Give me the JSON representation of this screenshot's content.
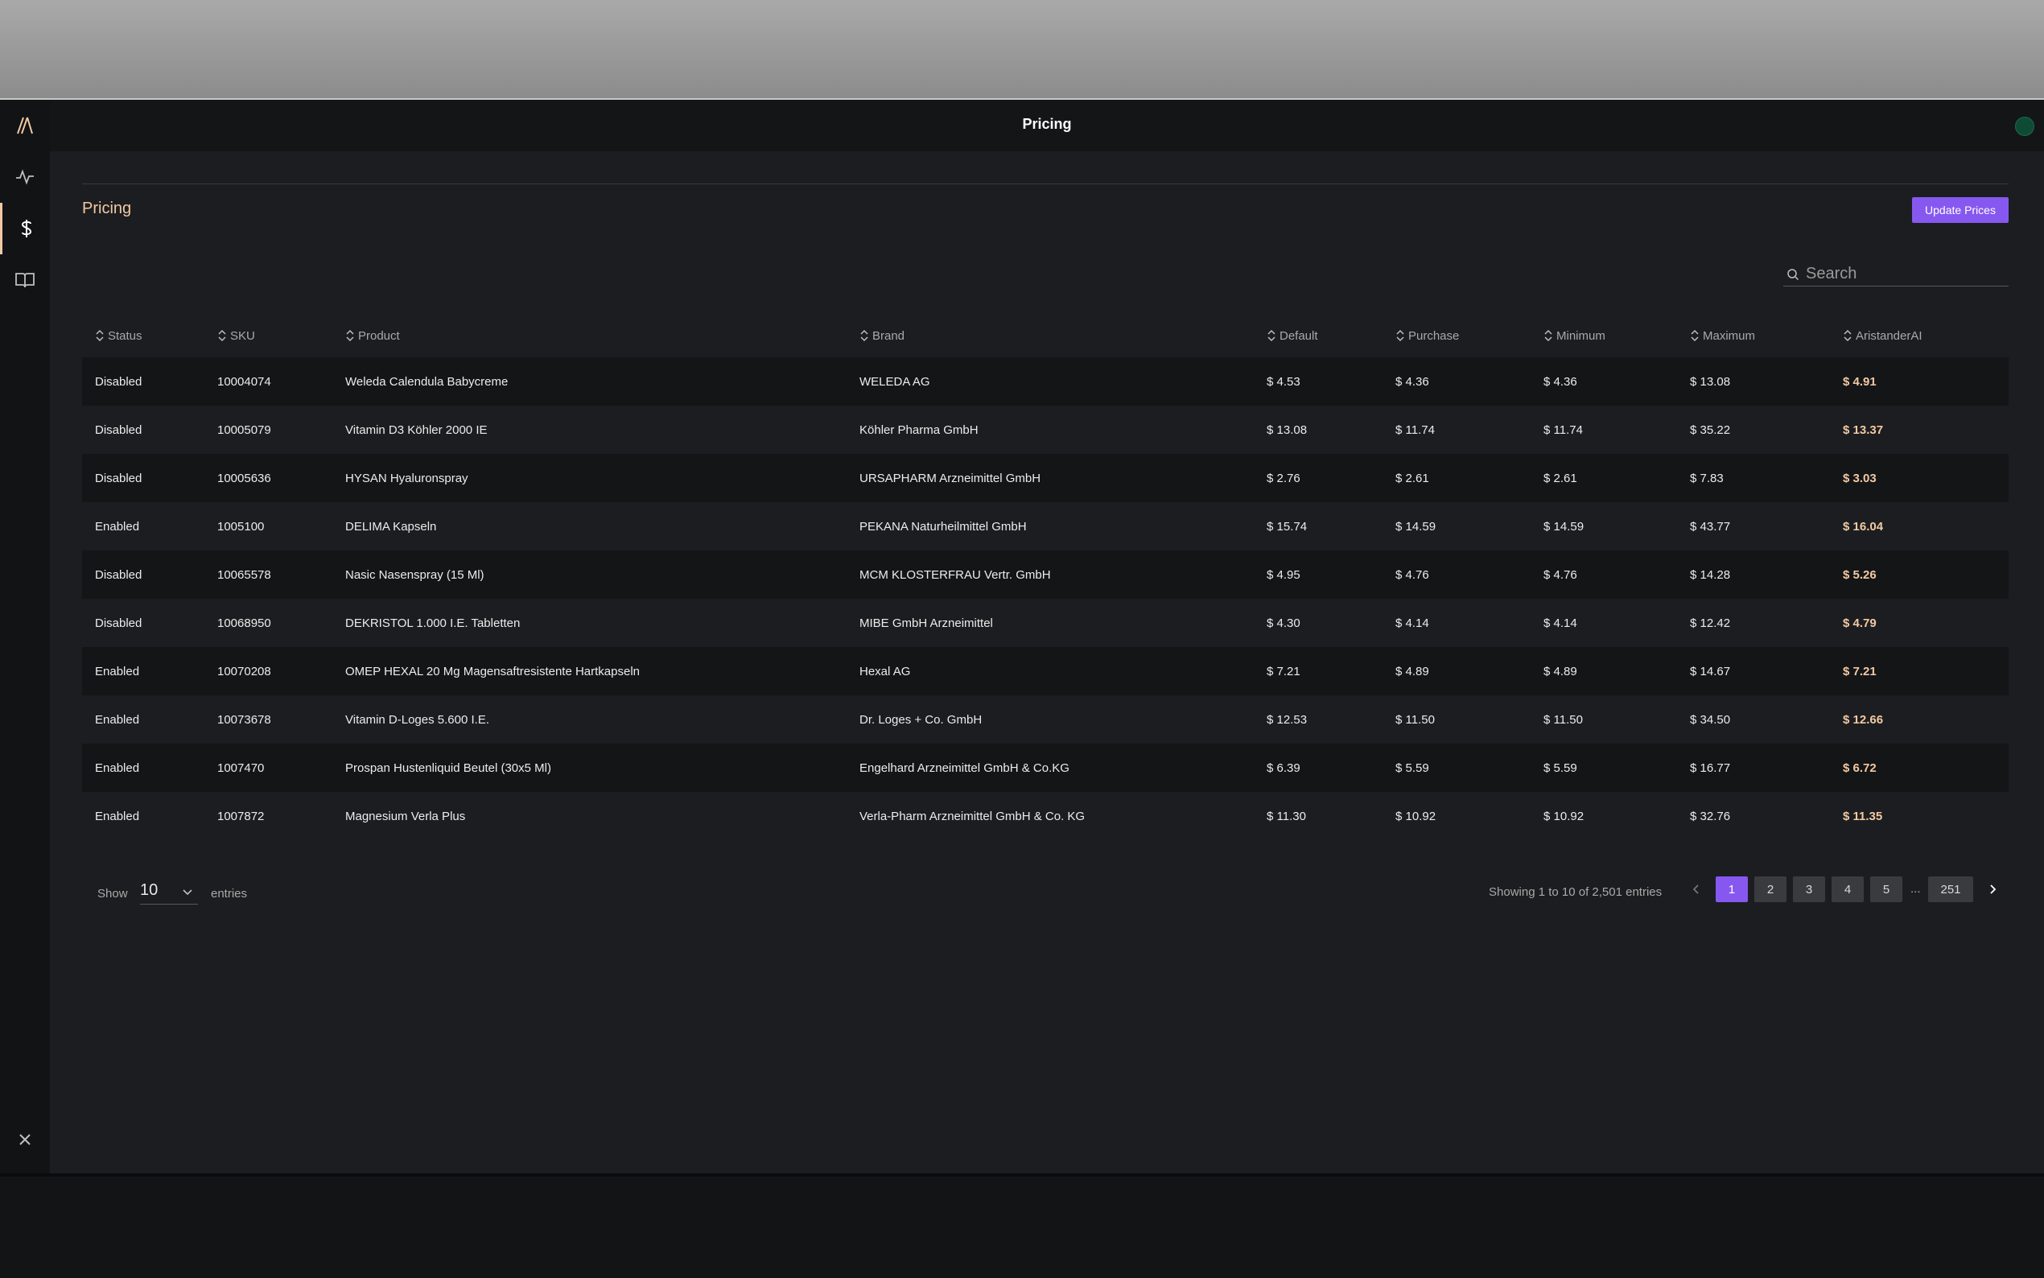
{
  "window": {
    "title": "Pricing"
  },
  "page": {
    "title": "Pricing",
    "update_label": "Update Prices"
  },
  "search": {
    "placeholder": "Search"
  },
  "sidebar": {
    "items": [
      "logo-icon",
      "activity-icon",
      "dollar-icon",
      "book-icon"
    ],
    "close": "close-icon"
  },
  "columns": [
    "Status",
    "SKU",
    "Product",
    "Brand",
    "Default",
    "Purchase",
    "Minimum",
    "Maximum",
    "AristanderAI"
  ],
  "rows": [
    [
      "Disabled",
      "10004074",
      "Weleda Calendula Babycreme",
      "WELEDA AG",
      "$ 4.53",
      "$ 4.36",
      "$ 4.36",
      "$ 13.08",
      "$ 4.91"
    ],
    [
      "Disabled",
      "10005079",
      "Vitamin D3 Köhler 2000 IE",
      "Köhler Pharma GmbH",
      "$ 13.08",
      "$ 11.74",
      "$ 11.74",
      "$ 35.22",
      "$ 13.37"
    ],
    [
      "Disabled",
      "10005636",
      "HYSAN Hyaluronspray",
      "URSAPHARM Arzneimittel GmbH",
      "$ 2.76",
      "$ 2.61",
      "$ 2.61",
      "$ 7.83",
      "$ 3.03"
    ],
    [
      "Enabled",
      "1005100",
      "DELIMA Kapseln",
      "PEKANA Naturheilmittel GmbH",
      "$ 15.74",
      "$ 14.59",
      "$ 14.59",
      "$ 43.77",
      "$ 16.04"
    ],
    [
      "Disabled",
      "10065578",
      "Nasic Nasenspray (15 Ml)",
      "MCM KLOSTERFRAU Vertr. GmbH",
      "$ 4.95",
      "$ 4.76",
      "$ 4.76",
      "$ 14.28",
      "$ 5.26"
    ],
    [
      "Disabled",
      "10068950",
      "DEKRISTOL 1.000 I.E. Tabletten",
      "MIBE GmbH Arzneimittel",
      "$ 4.30",
      "$ 4.14",
      "$ 4.14",
      "$ 12.42",
      "$ 4.79"
    ],
    [
      "Enabled",
      "10070208",
      "OMEP HEXAL 20 Mg Magensaftresistente Hartkapseln",
      "Hexal AG",
      "$ 7.21",
      "$ 4.89",
      "$ 4.89",
      "$ 14.67",
      "$ 7.21"
    ],
    [
      "Enabled",
      "10073678",
      "Vitamin D-Loges 5.600 I.E.",
      "Dr. Loges + Co. GmbH",
      "$ 12.53",
      "$ 11.50",
      "$ 11.50",
      "$ 34.50",
      "$ 12.66"
    ],
    [
      "Enabled",
      "1007470",
      "Prospan Hustenliquid Beutel (30x5 Ml)",
      "Engelhard Arzneimittel GmbH & Co.KG",
      "$ 6.39",
      "$ 5.59",
      "$ 5.59",
      "$ 16.77",
      "$ 6.72"
    ],
    [
      "Enabled",
      "1007872",
      "Magnesium Verla Plus",
      "Verla-Pharm Arzneimittel GmbH & Co. KG",
      "$ 11.30",
      "$ 10.92",
      "$ 10.92",
      "$ 32.76",
      "$ 11.35"
    ]
  ],
  "footer": {
    "show_label": "Show",
    "page_size": "10",
    "entries_label": "entries",
    "showing": "Showing 1 to 10 of 2,501 entries",
    "pages": [
      "1",
      "2",
      "3",
      "4",
      "5"
    ],
    "ellipsis": "...",
    "last_page": "251",
    "current_page": "1"
  },
  "colors": {
    "accent": "#8758f0",
    "highlight": "#f2c9a3",
    "background": "#1c1d20"
  }
}
